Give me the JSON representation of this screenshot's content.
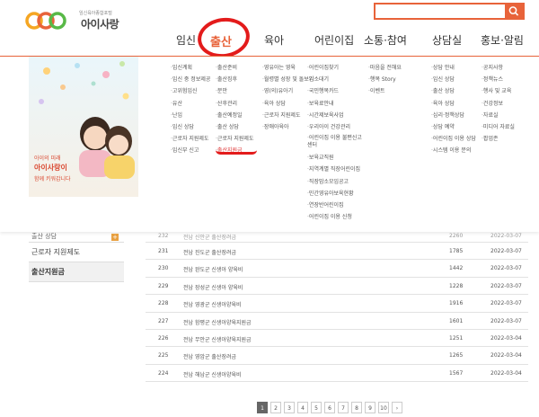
{
  "logo": {
    "subtitle": "임신육아종합포털",
    "name": "아이사랑"
  },
  "search": {
    "placeholder": ""
  },
  "nav": [
    "임신",
    "출산",
    "육아",
    "어린이집",
    "소통·참여",
    "상담실",
    "홍보·알림"
  ],
  "megamenu": {
    "promo": {
      "line1": "아이의 미래",
      "line2": "아이사랑이",
      "line3": "함께 키워갑니다"
    },
    "columns": [
      [
        "임신계획",
        "임신 중 정보제공",
        "고위험임신",
        "유산",
        "난임",
        "임신 상담",
        "근로자 지원제도",
        "임신부 신고"
      ],
      [
        "출산준비",
        "출산징후",
        "분만",
        "산후관리",
        "출산예정일",
        "출산 상담",
        "근로자 지원제도",
        "출산지원금"
      ],
      [
        "영유아는 영육",
        "월령별 성장 및 돌보기",
        "영(의)유아기",
        "육아 상담",
        "근로자 지원제도",
        "장애아육아"
      ],
      [
        "어린이집찾기",
        "입소대기",
        "국민행복카드",
        "보육료안내",
        "시간제보육사업",
        "우리아이 건강관리",
        "어린이집 이용 불편신고 센터",
        "보육교직원",
        "지역계별 직장어린이집",
        "직장맘소모임공고",
        "민간영유아보육현황",
        "연장반어린이집",
        "어린이집 이용 신청"
      ],
      [
        "마음을 전해요",
        "행복 Story",
        "이벤트"
      ],
      [
        "상담 안내",
        "임신 상담",
        "출산 상담",
        "육아 상담",
        "심리·정책상담",
        "상담 예약",
        "어린이집 이용 상담",
        "시스템 이용 문의"
      ],
      [
        "공지사항",
        "정책뉴스",
        "행사 및 교육",
        "건강정보",
        "자료실",
        "미디어 자료실",
        "팝업존"
      ]
    ]
  },
  "sidebar": {
    "items": [
      {
        "label": "출산 상담",
        "plus": "+"
      },
      {
        "label": "근로자 지원제도"
      },
      {
        "label": "출산지원금"
      }
    ]
  },
  "table": {
    "rows": [
      {
        "num": "232",
        "title": "전남 신안군 출산장려금",
        "views": "2260",
        "date": "2022-03-07"
      },
      {
        "num": "231",
        "title": "전남 진도군 출산장려금",
        "views": "1785",
        "date": "2022-03-07"
      },
      {
        "num": "230",
        "title": "전남 완도군 신생아 양육비",
        "views": "1442",
        "date": "2022-03-07"
      },
      {
        "num": "229",
        "title": "전남 장성군 신생아 양육비",
        "views": "1228",
        "date": "2022-03-07"
      },
      {
        "num": "228",
        "title": "전남 영광군 신생아양육비",
        "views": "1916",
        "date": "2022-03-07"
      },
      {
        "num": "227",
        "title": "전남 함평군 신생아양육지원금",
        "views": "1601",
        "date": "2022-03-07"
      },
      {
        "num": "226",
        "title": "전남 무안군 신생아양육지원금",
        "views": "1251",
        "date": "2022-03-04"
      },
      {
        "num": "225",
        "title": "전남 영암군 출산장려금",
        "views": "1265",
        "date": "2022-03-04"
      },
      {
        "num": "224",
        "title": "전남 해남군 신생아양육비",
        "views": "1567",
        "date": "2022-03-04"
      }
    ]
  },
  "pagination": [
    "1",
    "2",
    "3",
    "4",
    "5",
    "6",
    "7",
    "8",
    "9",
    "10",
    "›"
  ],
  "colors": {
    "accent": "#e8633a",
    "annotation": "#e31b1b"
  }
}
